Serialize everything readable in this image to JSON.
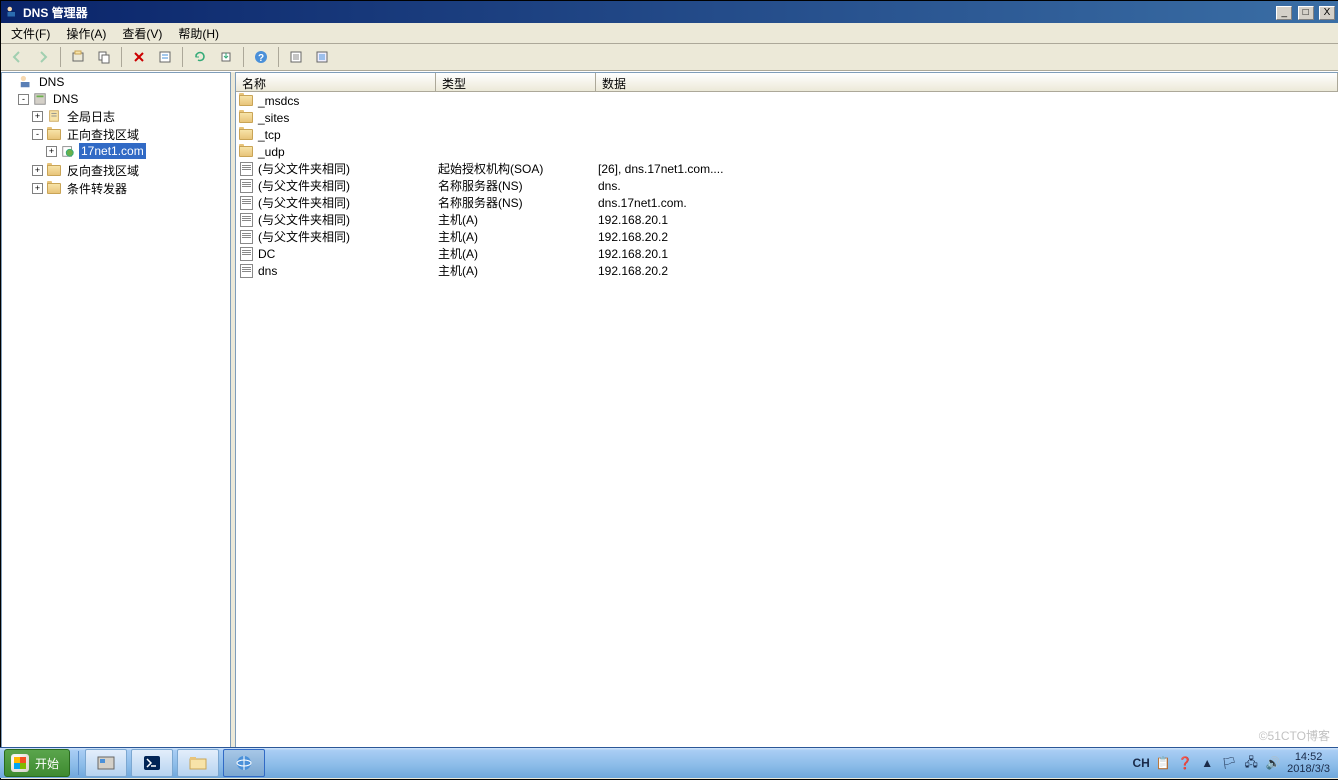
{
  "window": {
    "title": "DNS 管理器",
    "buttons": {
      "min": "_",
      "max": "□",
      "close": "X"
    }
  },
  "menu": [
    {
      "label": "文件(F)"
    },
    {
      "label": "操作(A)"
    },
    {
      "label": "查看(V)"
    },
    {
      "label": "帮助(H)"
    }
  ],
  "toolbar": [
    {
      "name": "nav-back",
      "icon": "arrow-left",
      "disabled": true
    },
    {
      "name": "nav-fwd",
      "icon": "arrow-right",
      "disabled": true
    },
    {
      "sep": true
    },
    {
      "name": "cut",
      "icon": "scissors"
    },
    {
      "name": "copy",
      "icon": "copy"
    },
    {
      "sep": true
    },
    {
      "name": "delete",
      "icon": "x"
    },
    {
      "name": "properties",
      "icon": "props"
    },
    {
      "sep": true
    },
    {
      "name": "refresh",
      "icon": "refresh"
    },
    {
      "name": "export",
      "icon": "export"
    },
    {
      "sep": true
    },
    {
      "name": "help",
      "icon": "help"
    },
    {
      "sep": true
    },
    {
      "name": "extra1",
      "icon": "list"
    },
    {
      "name": "extra2",
      "icon": "list2"
    }
  ],
  "tree": {
    "root": {
      "label": "DNS"
    },
    "server": {
      "label": "DNS"
    },
    "globalLog": {
      "label": "全局日志"
    },
    "fwdZone": {
      "label": "正向查找区域"
    },
    "zone1": {
      "label": "17net1.com"
    },
    "revZone": {
      "label": "反向查找区域"
    },
    "condFwd": {
      "label": "条件转发器"
    }
  },
  "columns": {
    "name": "名称",
    "type": "类型",
    "data": "数据"
  },
  "records": [
    {
      "icon": "folder",
      "name": "_msdcs",
      "type": "",
      "data": ""
    },
    {
      "icon": "folder",
      "name": "_sites",
      "type": "",
      "data": ""
    },
    {
      "icon": "folder",
      "name": "_tcp",
      "type": "",
      "data": ""
    },
    {
      "icon": "folder",
      "name": "_udp",
      "type": "",
      "data": ""
    },
    {
      "icon": "record",
      "name": "(与父文件夹相同)",
      "type": "起始授权机构(SOA)",
      "data": "[26], dns.17net1.com...."
    },
    {
      "icon": "record",
      "name": "(与父文件夹相同)",
      "type": "名称服务器(NS)",
      "data": "dns."
    },
    {
      "icon": "record",
      "name": "(与父文件夹相同)",
      "type": "名称服务器(NS)",
      "data": "dns.17net1.com."
    },
    {
      "icon": "record",
      "name": "(与父文件夹相同)",
      "type": "主机(A)",
      "data": "192.168.20.1"
    },
    {
      "icon": "record",
      "name": "(与父文件夹相同)",
      "type": "主机(A)",
      "data": "192.168.20.2"
    },
    {
      "icon": "record",
      "name": "DC",
      "type": "主机(A)",
      "data": "192.168.20.1"
    },
    {
      "icon": "record",
      "name": "dns",
      "type": "主机(A)",
      "data": "192.168.20.2"
    }
  ],
  "taskbar": {
    "start": "开始",
    "ime": "CH",
    "time": "14:52",
    "date": "2018/3/3"
  },
  "watermark": "©51CTO博客"
}
